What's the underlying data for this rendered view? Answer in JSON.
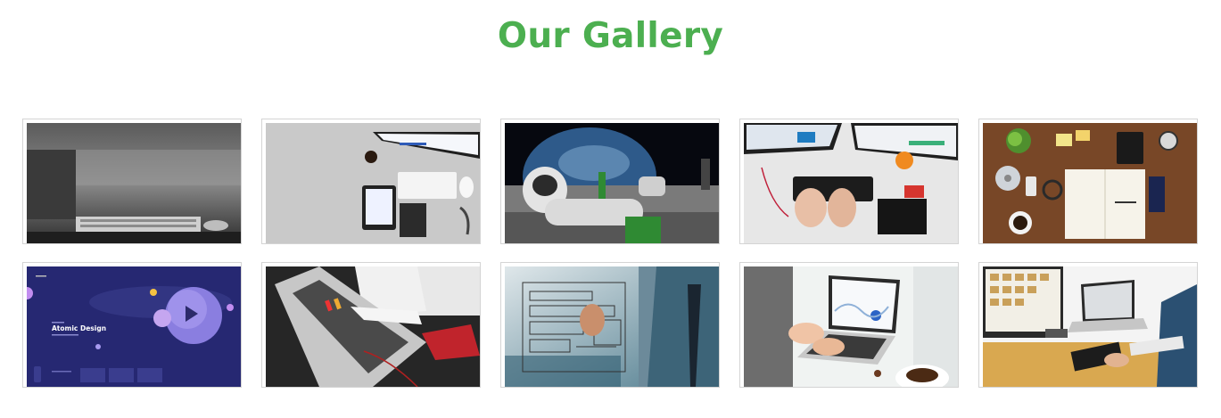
{
  "heading": "Our Gallery",
  "colors": {
    "accent": "#4caf50",
    "border": "#d4d4d4"
  },
  "gallery": {
    "items": [
      {
        "subject": "laptop-dark-desk"
      },
      {
        "subject": "tablet-keyboard-flatlay"
      },
      {
        "subject": "astronaut-on-moon"
      },
      {
        "subject": "hands-on-keyboard-desk"
      },
      {
        "subject": "business-flatlay-wood"
      },
      {
        "subject": "ui-design-mockup",
        "text": {
          "title": "Atomic Design"
        }
      },
      {
        "subject": "laptop-meeting-notes"
      },
      {
        "subject": "wireframe-sketch"
      },
      {
        "subject": "laptop-analytics"
      },
      {
        "subject": "designer-workspace"
      }
    ]
  }
}
